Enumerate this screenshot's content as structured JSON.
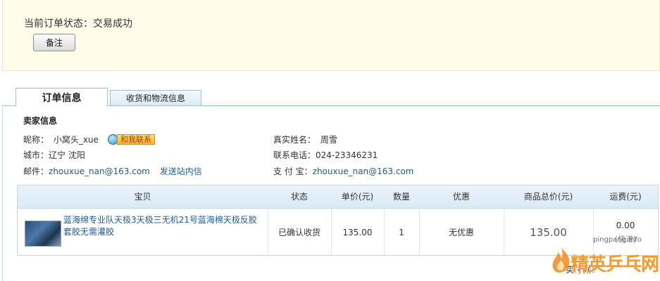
{
  "order_status": {
    "text": "当前订单状态：交易成功",
    "note_button": "备注"
  },
  "tabs": [
    {
      "label": "订单信息",
      "active": true
    },
    {
      "label": "收货和物流信息",
      "active": false
    }
  ],
  "seller": {
    "section_title": "卖家信息",
    "nickname_label": "昵称：",
    "nickname": "小窝头_xue",
    "contact_button": "和我联系",
    "city_label": "城市：",
    "city": "辽宁 沈阳",
    "email_label": "邮件：",
    "email": "zhouxue_nan@163.com",
    "site_message": "发送站内信",
    "realname_label": "真实姓名：",
    "realname": "周雪",
    "phone_label": "联系电话：",
    "phone": "024-23346231",
    "alipay_label": "支 付 宝：",
    "alipay": "zhouxue_nan@163.com"
  },
  "table": {
    "headers": {
      "item": "宝贝",
      "status": "状态",
      "unit_price": "单价(元)",
      "quantity": "数量",
      "discount": "优惠",
      "subtotal": "商品总价(元)",
      "shipping": "运费(元)"
    },
    "rows": [
      {
        "title": "蓝海绵专业队天极3天极三无机21号蓝海棉天极反胶套胶无需灌胶",
        "status": "已确认收货",
        "unit_price": "135.00",
        "quantity": "1",
        "discount": "无优惠",
        "subtotal": "135.00",
        "shipping": "0.00",
        "shipping_note": "(快递)"
      }
    ]
  },
  "footer_partial": "实付款：",
  "watermark": {
    "url": "pingpang.info",
    "brand": "精英乒乓网"
  },
  "colors": {
    "status_bg": "#fffde9",
    "link": "#1d5b97",
    "tab_border": "#9cc0dc",
    "header_bg": "#dbeaf6"
  }
}
